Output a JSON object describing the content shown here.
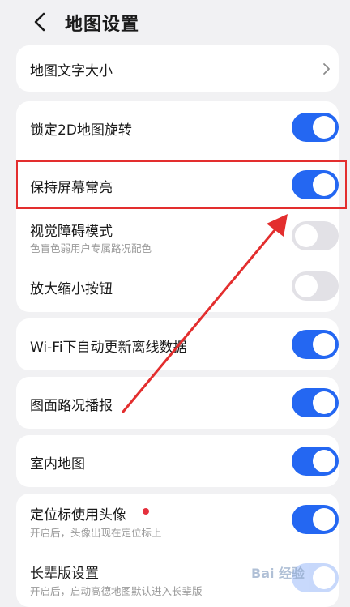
{
  "header": {
    "title": "地图设置",
    "back_icon": "chevron-left-icon"
  },
  "settings": {
    "text_size": {
      "label": "地图文字大小"
    },
    "lock_2d": {
      "label": "锁定2D地图旋转",
      "enabled": true
    },
    "keep_screen_on": {
      "label": "保持屏幕常亮",
      "enabled": true
    },
    "accessibility": {
      "label": "视觉障碍模式",
      "sub": "色盲色弱用户专属路况配色",
      "enabled": false
    },
    "zoom_buttons": {
      "label": "放大缩小按钮",
      "enabled": false
    },
    "wifi_update": {
      "label": "Wi-Fi下自动更新离线数据",
      "enabled": true
    },
    "traffic_broadcast": {
      "label": "图面路况播报",
      "enabled": true
    },
    "indoor_map": {
      "label": "室内地图",
      "enabled": true
    },
    "avatar_marker": {
      "label": "定位标使用头像",
      "sub": "开启后，头像出现在定位标上",
      "enabled": true
    },
    "elder_mode": {
      "label": "长辈版设置",
      "sub": "开启后，启动高德地图默认进入长辈版",
      "enabled": true
    }
  },
  "colors": {
    "accent": "#2467f2",
    "annotation": "#e32e2e",
    "background": "#f1f1f3"
  },
  "watermark": {
    "text": "Bai 经验"
  }
}
